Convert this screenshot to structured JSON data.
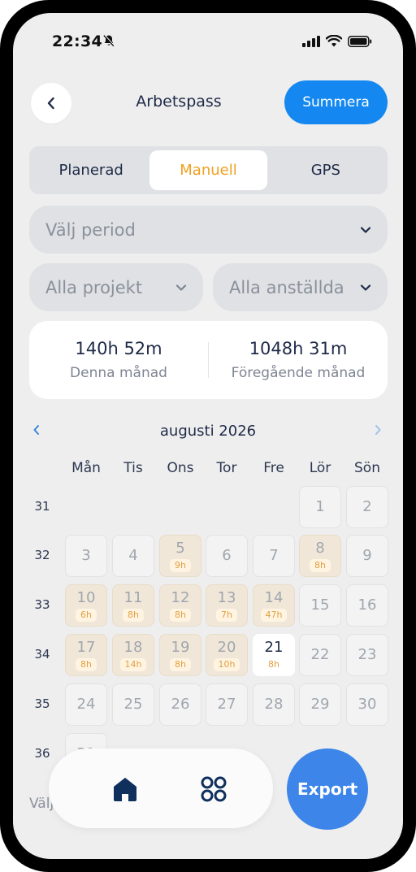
{
  "status_bar": {
    "time": "22:34"
  },
  "header": {
    "title": "Arbetspass",
    "summarize_label": "Summera"
  },
  "tabs": [
    {
      "label": "Planerad",
      "active": false
    },
    {
      "label": "Manuell",
      "active": true
    },
    {
      "label": "GPS",
      "active": false
    }
  ],
  "filters": {
    "period": "Välj period",
    "project": "Alla projekt",
    "employees": "Alla anställda"
  },
  "stats": {
    "this_month_value": "140h 52m",
    "this_month_label": "Denna månad",
    "previous_month_value": "1048h 31m",
    "previous_month_label": "Föregående månad"
  },
  "calendar": {
    "month_label": "augusti 2026",
    "weekdays": [
      "Mån",
      "Tis",
      "Ons",
      "Tor",
      "Fre",
      "Lör",
      "Sön"
    ],
    "weeks": [
      {
        "week": "31",
        "days": [
          null,
          null,
          null,
          null,
          null,
          {
            "d": "1"
          },
          {
            "d": "2"
          }
        ]
      },
      {
        "week": "32",
        "days": [
          {
            "d": "3"
          },
          {
            "d": "4"
          },
          {
            "d": "5",
            "h": "9h"
          },
          {
            "d": "6"
          },
          {
            "d": "7"
          },
          {
            "d": "8",
            "h": "8h"
          },
          {
            "d": "9"
          }
        ]
      },
      {
        "week": "33",
        "days": [
          {
            "d": "10",
            "h": "6h"
          },
          {
            "d": "11",
            "h": "8h"
          },
          {
            "d": "12",
            "h": "8h"
          },
          {
            "d": "13",
            "h": "7h"
          },
          {
            "d": "14",
            "h": "47h"
          },
          {
            "d": "15"
          },
          {
            "d": "16"
          }
        ]
      },
      {
        "week": "34",
        "days": [
          {
            "d": "17",
            "h": "8h"
          },
          {
            "d": "18",
            "h": "14h"
          },
          {
            "d": "19",
            "h": "8h"
          },
          {
            "d": "20",
            "h": "10h"
          },
          {
            "d": "21",
            "h": "8h",
            "today": true
          },
          {
            "d": "22"
          },
          {
            "d": "23"
          }
        ]
      },
      {
        "week": "35",
        "days": [
          {
            "d": "24"
          },
          {
            "d": "25"
          },
          {
            "d": "26"
          },
          {
            "d": "27"
          },
          {
            "d": "28"
          },
          {
            "d": "29"
          },
          {
            "d": "30"
          }
        ]
      },
      {
        "week": "36",
        "days": [
          {
            "d": "31"
          },
          null,
          null,
          null,
          null,
          null,
          null
        ]
      }
    ]
  },
  "bottom": {
    "export_label": "Export",
    "partial_text": "Välj"
  },
  "colors": {
    "accent": "#1488f0",
    "active_tab": "#f0a020",
    "export": "#3d85e9",
    "worked_day": "#f1e7d9"
  }
}
